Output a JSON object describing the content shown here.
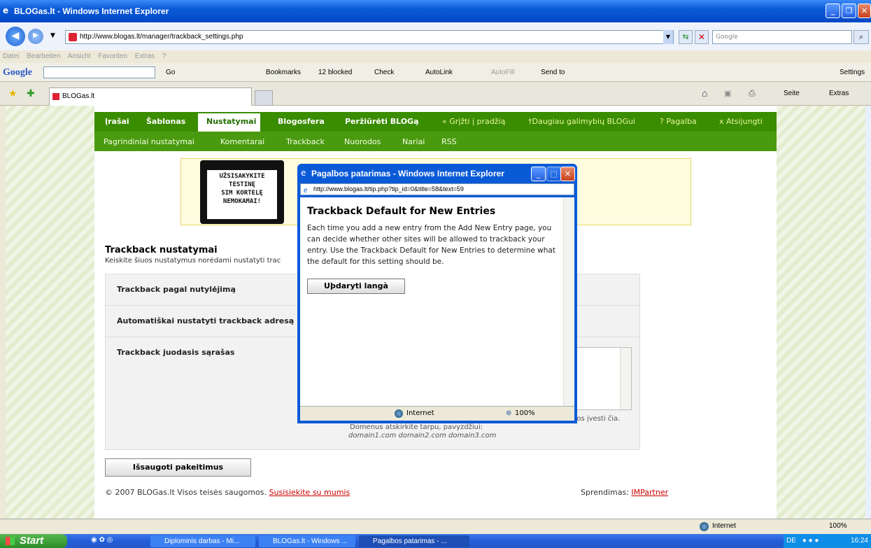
{
  "window": {
    "title": "BLOGas.lt - Windows Internet Explorer",
    "url": "http://www.blogas.lt/manager/trackback_settings.php",
    "search_placeholder": "Google",
    "menu": [
      "Datei",
      "Bearbeiten",
      "Ansicht",
      "Favoriten",
      "Extras",
      "?"
    ]
  },
  "googlebar": {
    "brand": "Google",
    "go": "Go",
    "bookmarks": "Bookmarks",
    "blocked": "12 blocked",
    "check": "Check",
    "autolink": "AutoLink",
    "autofill": "AutoFill",
    "sendto": "Send to",
    "settings": "Settings"
  },
  "tabs": {
    "active": "BLOGas.lt",
    "home_menu": "",
    "seite": "Seite",
    "extras": "Extras"
  },
  "nav_main": {
    "irasai": "Įrašai",
    "sablonas": "Šablonas",
    "nustatymai": "Nustatymai",
    "blogosfera": "Blogosfera",
    "perziureti": "Peržiūrėti BLOGą",
    "grizti": "« Grįžti į pradžią",
    "daugiau": "†Daugiau galimybių BLOGui",
    "pagalba": "? Pagalba",
    "atsijungti": "x Atsijungti"
  },
  "nav_sub": [
    "Pagrindiniai nustatymai",
    "Komentarai",
    "Trackback",
    "Nuorodos",
    "Nariai",
    "RSS"
  ],
  "banner": {
    "line1": "UŽSISAKYKITE",
    "line2": "TESTINĘ",
    "line3": "SIM KORTELĘ",
    "line4": "NEMOKAMAI!"
  },
  "page": {
    "heading": "Trackback nustatymai",
    "subheading": "Keiskite šiuos nustatymus norėdami nustatyti trac",
    "row1": "Trackback pagal nutylėjimą",
    "row2": "Automatiškai nustatyti trackback adresą",
    "row3": "Trackback juodasis sąrašas",
    "hint1": "uos įvesti čia.",
    "hint2": "Domenus atskirkite tarpu, pavyzdžiui:",
    "hint3": "domain1.com domain2.com domain3.com",
    "save": "Išsaugoti pakeitimus",
    "copyright": "© 2007 BLOGas.lt Visos teisės saugomos.",
    "contact": "Susisiekite su mumis",
    "solution_label": "Sprendimas:",
    "solution_link": "IMPartner"
  },
  "popup": {
    "title": "Pagalbos patarimas - Windows Internet Explorer",
    "url": "http://www.blogas.lt/tip.php?tip_id=0&title=58&text=59",
    "heading": "Trackback Default for New Entries",
    "text": "Each time you add a new entry from the Add New Entry page, you can decide whether other sites will be allowed to trackback your entry. Use the Trackback Default for New Entries to determine what the default for this setting should be.",
    "button": "Uþdaryti langà",
    "zone": "Internet",
    "zoom": "100%"
  },
  "statusbar": {
    "zone": "Internet",
    "zoom": "100%"
  },
  "taskbar": {
    "start": "Start",
    "task1": "Diplominis darbas - Mi...",
    "task2": "BLOGas.lt - Windows ...",
    "task3": "Pagalbos patarimas - ...",
    "lang": "DE",
    "time": "16:24"
  }
}
